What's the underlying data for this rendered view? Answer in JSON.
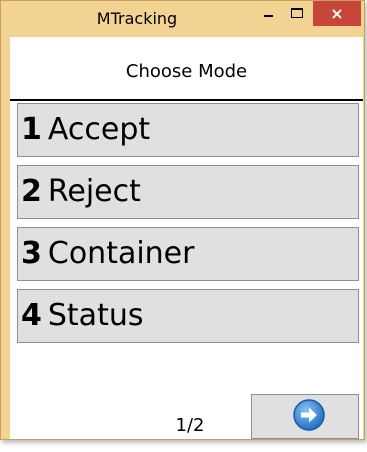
{
  "window": {
    "title": "MTracking",
    "close_label": "×"
  },
  "header": {
    "title": "Choose Mode"
  },
  "menu": {
    "items": [
      {
        "number": "1",
        "label": "Accept"
      },
      {
        "number": "2",
        "label": "Reject"
      },
      {
        "number": "3",
        "label": "Container"
      },
      {
        "number": "4",
        "label": "Status"
      }
    ]
  },
  "footer": {
    "page_indicator": "1/2",
    "next_icon": "arrow-right-circle-icon"
  },
  "colors": {
    "window_frame": "#f3d394",
    "close_button": "#c7463a",
    "button_background": "#e0e0e0",
    "next_icon": "#2f83d6"
  }
}
